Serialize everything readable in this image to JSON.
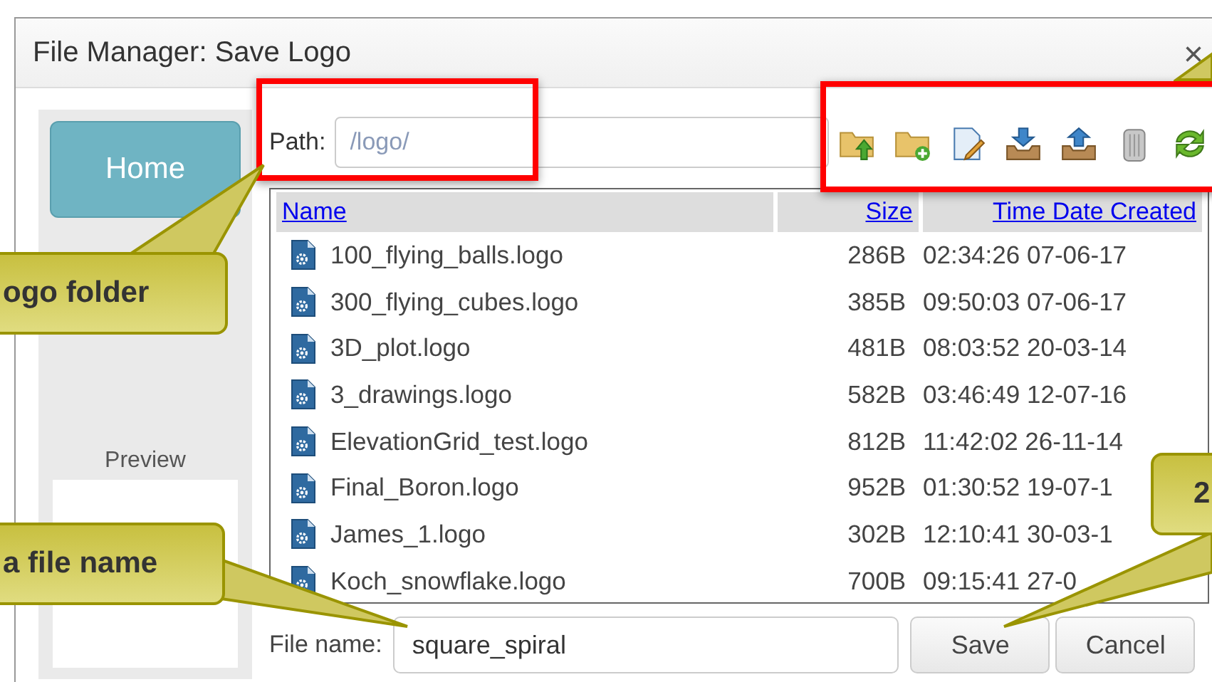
{
  "window": {
    "title": "File Manager: Save Logo",
    "close": "×"
  },
  "sidebar": {
    "home_button": "Home",
    "preview_label": "Preview"
  },
  "path": {
    "label": "Path:",
    "value": "/logo/"
  },
  "table": {
    "columns": [
      "Name",
      "Size",
      "Time Date Created"
    ],
    "rows": [
      {
        "name": "100_flying_balls.logo",
        "size": "286B",
        "created": "02:34:26 07-06-17"
      },
      {
        "name": "300_flying_cubes.logo",
        "size": "385B",
        "created": "09:50:03 07-06-17"
      },
      {
        "name": "3D_plot.logo",
        "size": "481B",
        "created": "08:03:52 20-03-14"
      },
      {
        "name": "3_drawings.logo",
        "size": "582B",
        "created": "03:46:49 12-07-16"
      },
      {
        "name": "ElevationGrid_test.logo",
        "size": "812B",
        "created": "11:42:02 26-11-14"
      },
      {
        "name": "Final_Boron.logo",
        "size": "952B",
        "created": "01:30:52 19-07-1"
      },
      {
        "name": "James_1.logo",
        "size": "302B",
        "created": "12:10:41 30-03-1"
      },
      {
        "name": "Koch_snowflake.logo",
        "size": "700B",
        "created": "09:15:41 27-0"
      }
    ]
  },
  "file_name": {
    "label": "File name:",
    "value": "square_spiral"
  },
  "buttons": [
    "Save",
    "Cancel"
  ],
  "callouts": [
    {
      "text": "ogo folder"
    },
    {
      "text": "a file name"
    },
    {
      "text": "2"
    }
  ]
}
